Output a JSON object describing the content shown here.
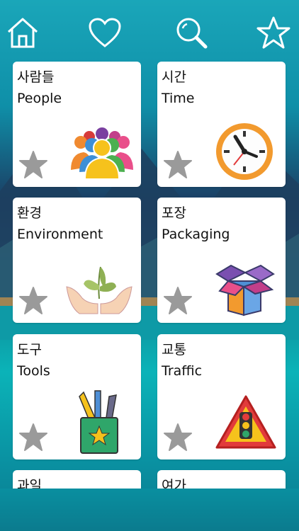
{
  "nav": {
    "home_icon": "home-icon",
    "favorites_icon": "heart-icon",
    "search_icon": "search-icon",
    "starred_icon": "star-icon"
  },
  "categories": [
    {
      "korean": "사람들",
      "english": "People",
      "icon": "people-group-icon"
    },
    {
      "korean": "시간",
      "english": "Time",
      "icon": "clock-icon"
    },
    {
      "korean": "환경",
      "english": "Environment",
      "icon": "hands-plant-icon"
    },
    {
      "korean": "포장",
      "english": "Packaging",
      "icon": "open-box-icon"
    },
    {
      "korean": "도구",
      "english": "Tools",
      "icon": "pencil-cup-icon"
    },
    {
      "korean": "교통",
      "english": "Traffic",
      "icon": "traffic-sign-icon"
    },
    {
      "korean": "과일",
      "english": ""
    },
    {
      "korean": "여가",
      "english": ""
    }
  ],
  "colors": {
    "accent": "#1aa6b9",
    "card": "#ffffff",
    "star_inactive": "#9a9a9a"
  }
}
